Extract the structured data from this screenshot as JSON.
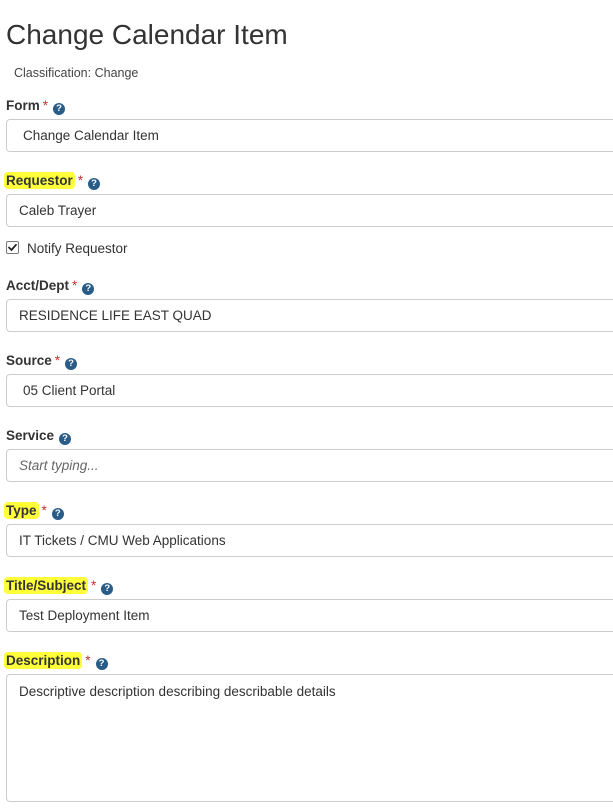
{
  "page": {
    "title": "Change Calendar Item",
    "classification": "Classification: Change"
  },
  "fields": {
    "form": {
      "label": "Form",
      "required": "*",
      "value": "Change Calendar Item"
    },
    "requestor": {
      "label": "Requestor",
      "required": "*",
      "value": "Caleb Trayer",
      "highlighted": true
    },
    "notify": {
      "label": "Notify Requestor",
      "checked": true
    },
    "acct_dept": {
      "label": "Acct/Dept",
      "required": "*",
      "value": "RESIDENCE LIFE EAST QUAD"
    },
    "source": {
      "label": "Source",
      "required": "*",
      "value": "05 Client Portal"
    },
    "service": {
      "label": "Service",
      "placeholder": "Start typing..."
    },
    "type": {
      "label": "Type",
      "required": "*",
      "value": "IT Tickets / CMU Web Applications",
      "highlighted": true
    },
    "title_subject": {
      "label": "Title/Subject",
      "required": "*",
      "value": "Test Deployment Item",
      "highlighted": true
    },
    "description": {
      "label": "Description",
      "required": "*",
      "value": "Descriptive description describing describable details",
      "highlighted": true
    }
  },
  "icons": {
    "help": "question-circle-icon",
    "help_glyph": "?"
  },
  "colors": {
    "highlight": "#ffff3a",
    "required": "#c9302c",
    "help_icon": "#2a5c8a"
  }
}
